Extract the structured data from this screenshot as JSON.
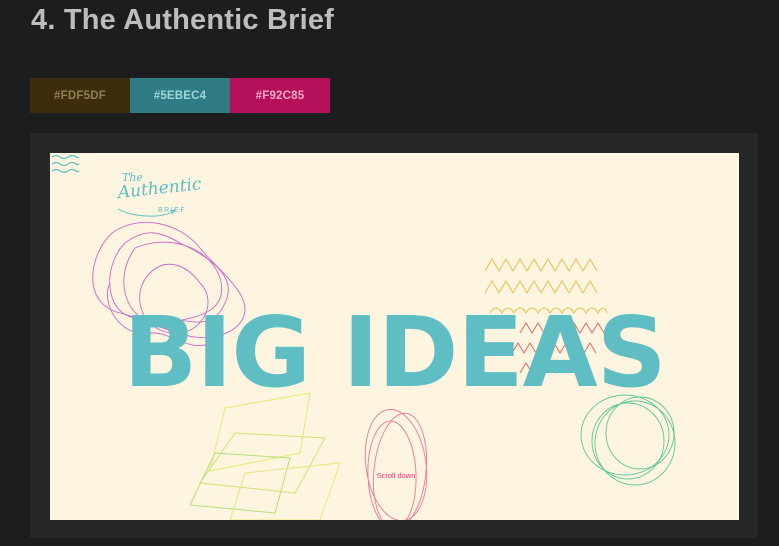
{
  "section": {
    "heading": "4. The Authentic Brief"
  },
  "palette": [
    {
      "label": "#FDF5DF",
      "color": "#FDF5DF",
      "bg": "#3c2e0c",
      "text": "#8f7f52"
    },
    {
      "label": "#5EBEC4",
      "color": "#5EBEC4",
      "bg": "#2f7c84",
      "text": "#a0d7da"
    },
    {
      "label": "#F92C85",
      "color": "#F92C85",
      "bg": "#b5115a",
      "text": "#f7a9c9"
    }
  ],
  "preview": {
    "background": "#FDF5DF",
    "logo": {
      "line1": "The",
      "line2": "Authentic",
      "line3": "BRIEF"
    },
    "menu_icon": "wave-menu-icon",
    "headline": "BIG IDEAS",
    "scroll_label": "Scroll down"
  }
}
